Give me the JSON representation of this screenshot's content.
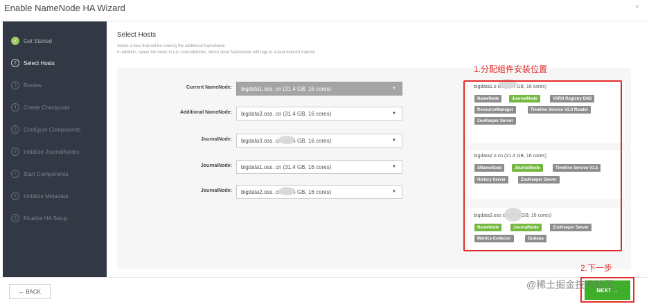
{
  "modal": {
    "title": "Enable NameNode HA Wizard",
    "close": "×"
  },
  "steps": [
    {
      "num": "✓",
      "label": "Get Started",
      "state": "done"
    },
    {
      "num": "2",
      "label": "Select Hosts",
      "state": "active"
    },
    {
      "num": "3",
      "label": "Review",
      "state": "pending"
    },
    {
      "num": "4",
      "label": "Create Checkpoint",
      "state": "pending"
    },
    {
      "num": "5",
      "label": "Configure Components",
      "state": "pending"
    },
    {
      "num": "6",
      "label": "Initialize JournalNodes",
      "state": "pending"
    },
    {
      "num": "7",
      "label": "Start Components",
      "state": "pending"
    },
    {
      "num": "8",
      "label": "Initialize Metadata",
      "state": "pending"
    },
    {
      "num": "9",
      "label": "Finalize HA Setup",
      "state": "pending"
    }
  ],
  "section": {
    "title": "Select Hosts",
    "desc1": "Select a host that will be running the additional NameNode",
    "desc2": "In addition, select the hosts to run JournalNodes, which store NameNode edit logs in a fault tolerant manner"
  },
  "form": [
    {
      "label": "Current NameNode:",
      "value": "bigdata1.oss.        cn (31.4 GB, 16 cores)"
    },
    {
      "label": "Additional NameNode:",
      "value": "bigdata3.oss.        cn (31.4 GB, 16 cores)"
    },
    {
      "label": "JournalNode:",
      "value": "bigdata3.oss.        cn (31.4 GB, 16 cores)"
    },
    {
      "label": "JournalNode:",
      "value": "bigdata1.oss.        cn (31.4 GB, 16 cores)"
    },
    {
      "label": "JournalNode:",
      "value": "bigdata2.oss.        cn (31.4 GB, 16 cores)"
    }
  ],
  "hosts": [
    {
      "name": "bigdata1.o          cn (31.4 GB, 16 cores)",
      "tags": [
        {
          "text": "NameNode",
          "color": "grey"
        },
        {
          "text": "JournalNode",
          "color": "green"
        },
        {
          "text": "YARN Registry DNS",
          "color": "grey"
        },
        {
          "text": "ResourceManager",
          "color": "grey"
        },
        {
          "text": "Timeline Service V2.0 Reader",
          "color": "grey"
        },
        {
          "text": "ZooKeeper Server",
          "color": "grey"
        }
      ]
    },
    {
      "name": "bigdata2.o          cn (31.4 GB, 16 cores)",
      "tags": [
        {
          "text": "SNameNode",
          "color": "grey"
        },
        {
          "text": "JournalNode",
          "color": "green"
        },
        {
          "text": "Timeline Service V1.5",
          "color": "grey"
        },
        {
          "text": "History Server",
          "color": "grey"
        },
        {
          "text": "ZooKeeper Server",
          "color": "grey"
        }
      ]
    },
    {
      "name": "bigdata3.oss          cn (31.4 GB, 16 cores)",
      "tags": [
        {
          "text": "NameNode",
          "color": "green"
        },
        {
          "text": "JournalNode",
          "color": "green"
        },
        {
          "text": "ZooKeeper Server",
          "color": "grey"
        },
        {
          "text": "Metrics Collector",
          "color": "grey"
        },
        {
          "text": "Grafana",
          "color": "grey"
        }
      ]
    }
  ],
  "annotations": {
    "assign": "1.分配组件安装位置",
    "next": "2.下一步"
  },
  "footer": {
    "back": "← BACK",
    "next": "NEXT →"
  },
  "watermark": "@稀土掘金技术社区",
  "colors": {
    "accent_green": "#3fae2a",
    "tag_green": "#75b83f",
    "sidebar": "#323844",
    "annotation_red": "#e02b2b"
  }
}
